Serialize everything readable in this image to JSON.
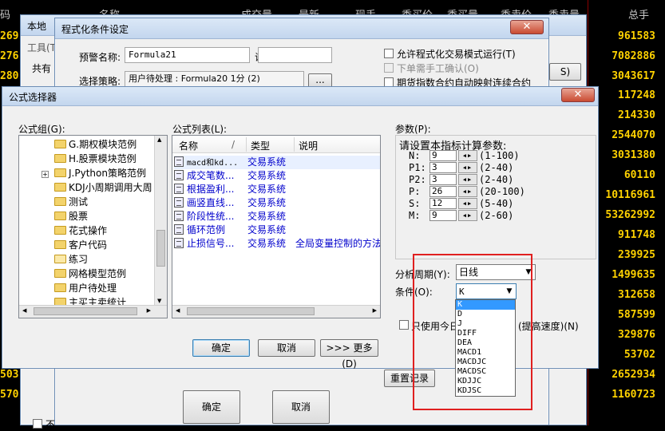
{
  "background": {
    "headers": [
      "码",
      "名称",
      "成交量",
      "最新",
      "现手",
      "委买价",
      "委买量",
      "委卖价",
      "委卖量",
      "总手"
    ],
    "left_codes": [
      "269",
      "276",
      "280",
      "",
      "",
      "",
      "",
      "",
      "",
      "",
      "",
      "",
      "",
      "",
      "",
      "",
      "",
      "",
      "",
      "",
      "",
      "",
      "",
      "503",
      "570"
    ],
    "total_volume": [
      "961583",
      "7082886",
      "3043617",
      "117248",
      "214330",
      "2544070",
      "3031380",
      "60110",
      "10116961",
      "53262992",
      "911748",
      "239925",
      "1499635",
      "312658",
      "587599",
      "329876",
      "53702",
      "2652934",
      "1160723"
    ],
    "accent_yellow": "#ffd200",
    "grid_red": "#8b0000"
  },
  "back_window": {
    "title_prefix": "本地",
    "toolbar_tab": "工具(T)",
    "shared_label": "共有",
    "s_button": "S)"
  },
  "condition_dialog": {
    "title": "程式化条件设定",
    "alert_name_label": "预警名称:",
    "alert_name_value": "Formula21",
    "description_label": "说明",
    "description_value": "",
    "strategy_label": "选择策略:",
    "strategy_value": "用户待处理 : Formula20 1分 (2)",
    "browse_label": "...",
    "opt_programmatic": "允许程式化交易模式运行(T)",
    "opt_manual_confirm": "下单需手工确认(O)",
    "opt_futures": "期货指数合约自动映射连续合约",
    "ok_label": "确定",
    "cancel_label": "取消",
    "reset_label": "重置记录",
    "not_label": "不"
  },
  "formula_selector": {
    "title": "公式选择器",
    "group_label": "公式组(G):",
    "list_label": "公式列表(L):",
    "params_label": "参数(P):",
    "tree": [
      {
        "label": "G.期权模块范例",
        "expand": ""
      },
      {
        "label": "H.股票模块范例",
        "expand": ""
      },
      {
        "label": "J.Python策略范例",
        "expand": "+"
      },
      {
        "label": "KDJ小周期调用大周",
        "expand": ""
      },
      {
        "label": "测试",
        "expand": ""
      },
      {
        "label": "股票",
        "expand": ""
      },
      {
        "label": "花式操作",
        "expand": ""
      },
      {
        "label": "客户代码",
        "expand": ""
      },
      {
        "label": "练习",
        "expand": ""
      },
      {
        "label": "网格模型范例",
        "expand": ""
      },
      {
        "label": "用户待处理",
        "expand": ""
      },
      {
        "label": "主买主卖统计",
        "expand": ""
      }
    ],
    "columns": {
      "name": "名称",
      "sort": "/",
      "type": "类型",
      "note": "说明"
    },
    "formulas": [
      {
        "name": "macd和kd...",
        "type": "交易系统",
        "note": ""
      },
      {
        "name": "成交笔数...",
        "type": "交易系统",
        "note": ""
      },
      {
        "name": "根据盈利...",
        "type": "交易系统",
        "note": ""
      },
      {
        "name": "画竖直线...",
        "type": "交易系统",
        "note": ""
      },
      {
        "name": "阶段性统...",
        "type": "交易系统",
        "note": ""
      },
      {
        "name": "循环范例",
        "type": "交易系统",
        "note": ""
      },
      {
        "name": "止损信号...",
        "type": "交易系统",
        "note": "全局变量控制的方法"
      }
    ],
    "params_heading": "请设置本指标计算参数:",
    "params": [
      {
        "name": "N:",
        "value": "9",
        "range": "(1-100)"
      },
      {
        "name": "P1:",
        "value": "3",
        "range": "(2-40)"
      },
      {
        "name": "P2:",
        "value": "3",
        "range": "(2-40)"
      },
      {
        "name": "P:",
        "value": "26",
        "range": "(20-100)"
      },
      {
        "name": "S:",
        "value": "12",
        "range": "(5-40)"
      },
      {
        "name": "M:",
        "value": "9",
        "range": "(2-60)"
      }
    ],
    "period_label": "分析周期(Y):",
    "period_value": "日线",
    "condition_label": "条件(O):",
    "condition_value": "K",
    "condition_options": [
      "K",
      "D",
      "J",
      "DIFF",
      "DEA",
      "MACD1",
      "MACDJC",
      "MACDSC",
      "KDJJC",
      "KDJSC"
    ],
    "only_today_label": "只使用今日",
    "speed_label": "(提高速度)(N)",
    "ok_label": "确定",
    "cancel_label": "取消",
    "more_label": ">>> 更多(D)",
    "highlight_color": "#e02020"
  }
}
